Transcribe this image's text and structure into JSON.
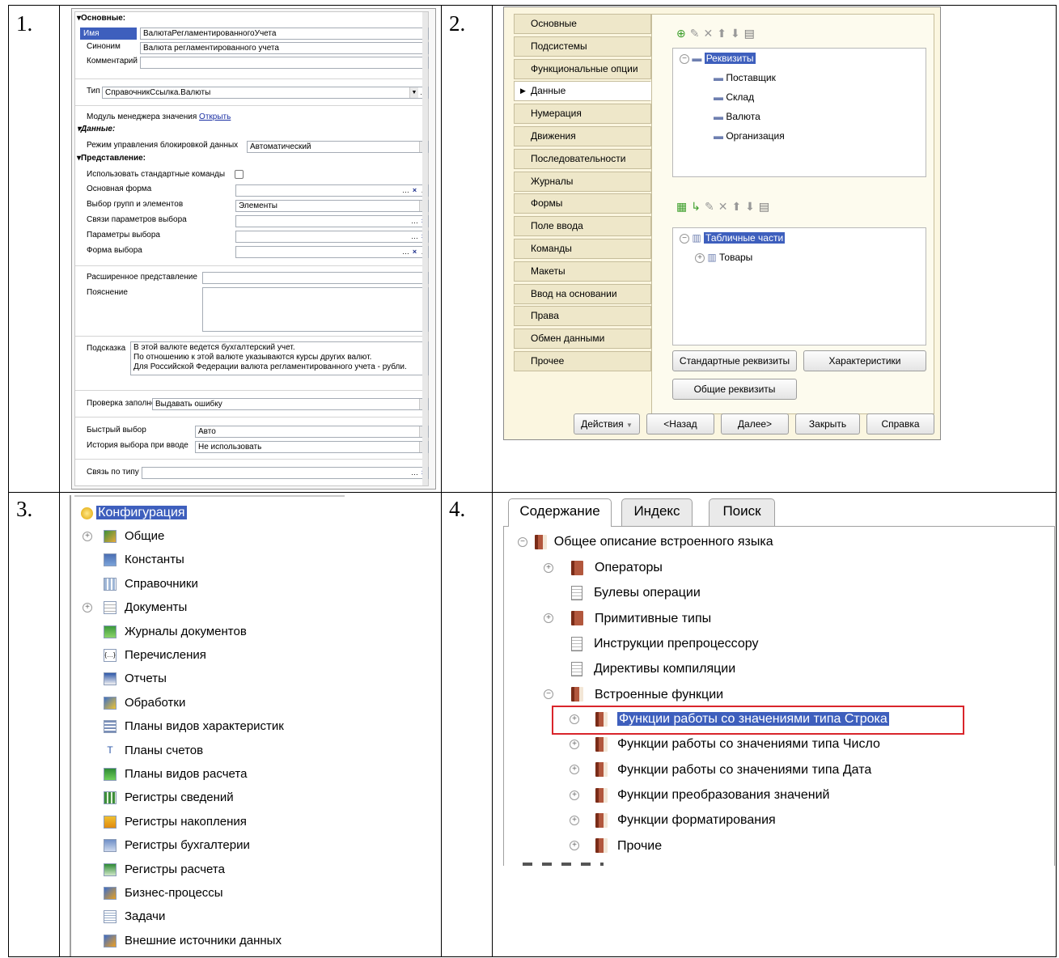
{
  "cells": {
    "n1": "1.",
    "n2": "2.",
    "n3": "3.",
    "n4": "4."
  },
  "p1": {
    "sec_main": "Основные:",
    "name_label": "Имя",
    "name_value": "ВалютаРегламентированногоУчета",
    "syn_label": "Синоним",
    "syn_value": "Валюта регламентированного учета",
    "comment_label": "Комментарий",
    "type_label": "Тип",
    "type_value": "СправочникСсылка.Валюты",
    "module_label": "Модуль менеджера значения",
    "module_link": "Открыть",
    "sec_data": "Данные:",
    "lock_label": "Режим управления блокировкой данных",
    "lock_value": "Автоматический",
    "sec_view": "Представление:",
    "std_cmd_label": "Использовать стандартные команды",
    "main_form_label": "Основная форма",
    "groups_label": "Выбор групп и элементов",
    "groups_value": "Элементы",
    "links_label": "Связи параметров выбора",
    "params_label": "Параметры выбора",
    "choice_form_label": "Форма выбора",
    "ext_label": "Расширенное представление",
    "expl_label": "Пояснение",
    "hint_label": "Подсказка",
    "hint_lines": [
      "В этой валюте ведется бухгалтерский учет.",
      "По отношению к этой валюте указываются курсы других валют.",
      "Для Российской Федерации валюта регламентированного учета - рубли."
    ],
    "fill_label": "Проверка заполнения",
    "fill_value": "Выдавать ошибку",
    "quick_label": "Быстрый выбор",
    "quick_value": "Авто",
    "history_label": "История выбора при вводе",
    "history_value": "Не использовать",
    "link_type_label": "Связь по типу"
  },
  "p2": {
    "tabs": [
      "Основные",
      "Подсистемы",
      "Функциональные опции",
      "Данные",
      "Нумерация",
      "Движения",
      "Последовательности",
      "Журналы",
      "Формы",
      "Поле ввода",
      "Команды",
      "Макеты",
      "Ввод на основании",
      "Права",
      "Обмен данными",
      "Прочее"
    ],
    "req_root": "Реквизиты",
    "req_items": [
      "Поставщик",
      "Склад",
      "Валюта",
      "Организация"
    ],
    "tab_root": "Табличные части",
    "tab_items": [
      "Товары"
    ],
    "btn_std": "Стандартные реквизиты",
    "btn_char": "Характеристики",
    "btn_common": "Общие реквизиты",
    "btn_actions": "Действия",
    "btn_back": "<Назад",
    "btn_next": "Далее>",
    "btn_close": "Закрыть",
    "btn_help": "Справка"
  },
  "p3": {
    "root": "Конфигурация",
    "items": [
      "Общие",
      "Константы",
      "Справочники",
      "Документы",
      "Журналы документов",
      "Перечисления",
      "Отчеты",
      "Обработки",
      "Планы видов характеристик",
      "Планы счетов",
      "Планы видов расчета",
      "Регистры сведений",
      "Регистры накопления",
      "Регистры бухгалтерии",
      "Регистры расчета",
      "Бизнес-процессы",
      "Задачи",
      "Внешние источники данных"
    ]
  },
  "p4": {
    "tabs": [
      "Содержание",
      "Индекс",
      "Поиск"
    ],
    "root": "Общее описание встроенного языка",
    "l1": [
      "Операторы",
      "Булевы операции",
      "Примитивные типы",
      "Инструкции препроцессору",
      "Директивы компиляции",
      "Встроенные функции"
    ],
    "l2": [
      "Функции работы со значениями типа Строка",
      "Функции работы со значениями типа Число",
      "Функции работы со значениями типа Дата",
      "Функции преобразования значений",
      "Функции форматирования",
      "Прочие"
    ]
  }
}
